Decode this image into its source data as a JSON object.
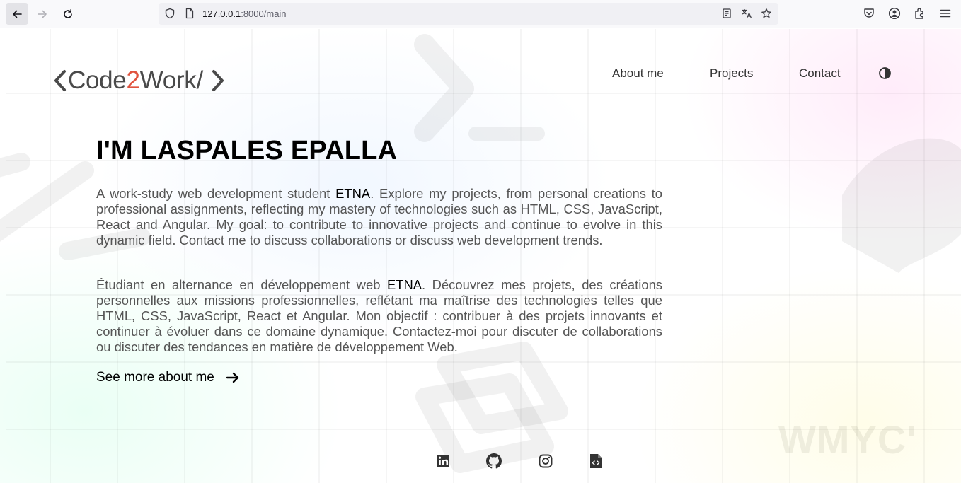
{
  "browser": {
    "url_host": "127.0.0.1",
    "url_rest": ":8000/main"
  },
  "site": {
    "logo": {
      "part1": "Code",
      "part2": "2",
      "part3": "Work/"
    },
    "nav": [
      {
        "label": "About me"
      },
      {
        "label": "Projects"
      },
      {
        "label": "Contact"
      }
    ]
  },
  "hero": {
    "title": "I'M LASPALES EPALLA",
    "para_en": {
      "before": "A work-study web development student ",
      "highlight": "ETNA",
      "after": ". Explore my projects, from personal creations to professional assignments, reflecting my mastery of technologies such as HTML, CSS, JavaScript, React and Angular. My goal: to contribute to innovative projects and continue to evolve in this dynamic field. Contact me to discuss collaborations or discuss web development trends."
    },
    "para_fr": {
      "before": "Étudiant en alternance en développement web ",
      "highlight": "ETNA",
      "after": ". Découvrez mes projets, des créations personnelles aux missions professionnelles, reflétant ma maîtrise des technologies telles que HTML, CSS, JavaScript, React et Angular. Mon objectif : contribuer à des projets innovants et continuer à évoluer dans ce domaine dynamique. Contactez-moi pour discuter de collaborations ou discuter des tendances en matière de développement Web."
    },
    "cta": "See more about me"
  },
  "watermark": "WMYC'",
  "social": [
    "linkedin-icon",
    "github-icon",
    "instagram-icon",
    "resume-code-icon"
  ],
  "colors": {
    "accent": "#e0533e",
    "text": "#555555",
    "heading": "#000000"
  }
}
